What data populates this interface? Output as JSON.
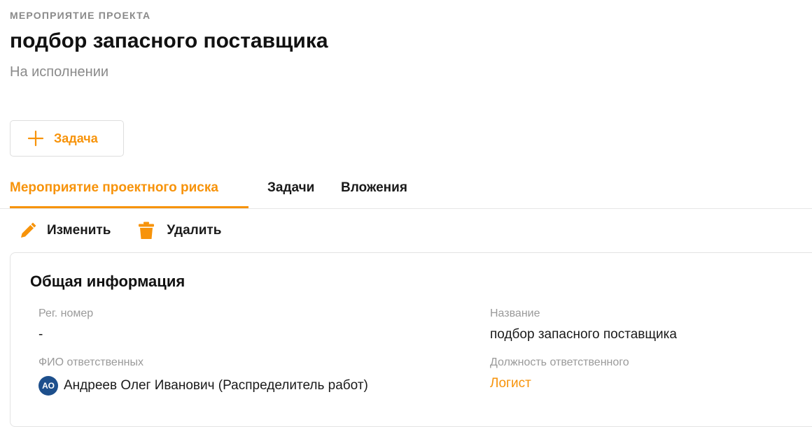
{
  "header": {
    "overline": "МЕРОПРИЯТИЕ ПРОЕКТА",
    "title": "подбор запасного поставщика",
    "status": "На исполнении"
  },
  "add_task": {
    "label": "Задача",
    "icon": "plus-icon"
  },
  "tabs": [
    {
      "label": "Мероприятие проектного риска",
      "active": true
    },
    {
      "label": "Задачи",
      "active": false
    },
    {
      "label": "Вложения",
      "active": false
    }
  ],
  "actions": {
    "edit": {
      "label": "Изменить",
      "icon": "pencil-icon"
    },
    "delete": {
      "label": "Удалить",
      "icon": "trash-icon"
    }
  },
  "info": {
    "title": "Общая информация",
    "reg_number": {
      "label": "Рег. номер",
      "value": "-"
    },
    "name": {
      "label": "Название",
      "value": "подбор запасного поставщика"
    },
    "responsible": {
      "label": "ФИО ответственных",
      "initials": "АО",
      "value": "Андреев Олег Иванович (Распределитель работ)"
    },
    "position": {
      "label": "Должность ответственного",
      "value": "Логист"
    }
  },
  "colors": {
    "accent": "#f7930a",
    "muted": "#8a8a8a",
    "avatar": "#1d4f8c"
  }
}
